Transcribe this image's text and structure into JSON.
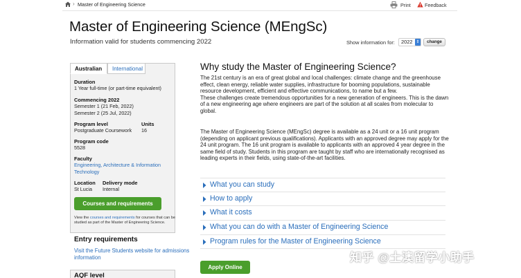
{
  "breadcrumb": {
    "current": "Master of Engineering Science"
  },
  "toolbar": {
    "print_label": "Print",
    "feedback_label": "Feedback"
  },
  "header": {
    "title": "Master of Engineering Science (MEngSc)",
    "subtitle": "Information valid for students commencing 2022",
    "show_info_label": "Show information for:",
    "year_value": "2022",
    "change_label": "change"
  },
  "sidebar": {
    "tabs": [
      "Australian",
      "International"
    ],
    "duration_label": "Duration",
    "duration_value": "1 Year full-time (or part-time equivalent)",
    "commencing_label": "Commencing 2022",
    "commencing_sem1": "Semester 1 (21 Feb, 2022)",
    "commencing_sem2": "Semester 2 (25 Jul, 2022)",
    "program_level_label": "Program level",
    "program_level_value": "Postgraduate Coursework",
    "units_label": "Units",
    "units_value": "16",
    "program_code_label": "Program code",
    "program_code_value": "5528",
    "faculty_label": "Faculty",
    "faculty_value": "Engineering, Architecture & Information Technology",
    "location_label": "Location",
    "location_value": "St Lucia",
    "delivery_label": "Delivery mode",
    "delivery_value": "Internal",
    "courses_button": "Courses and requirements",
    "note_prefix": "View the ",
    "note_link": "courses and requirements",
    "note_suffix": " for courses that can be studied as part of the Master of Engineering Science.",
    "entry_heading": "Entry requirements",
    "entry_link": "Visit the Future Students website for admissions information",
    "aqf_heading": "AQF level"
  },
  "main": {
    "heading": "Why study the Master of Engineering Science?",
    "paragraph1a": "The 21st century is an era of great global and local challenges: climate change and the greenhouse effect, clean energy, reliable water supplies, infrastructure for booming populations, sustainable resource development, efficient and effective communications, to name but a few.",
    "paragraph1b": "These challenges create tremendous opportunities for a new generation of engineers. This is the dawn of a new engineering age where engineers are part of the solution at all scales from molecular to global.",
    "paragraph2": "The Master of Engineering Science (MEngSc) degree is available as a 24 unit or a 16 unit program (depending on applicant previous qualifications). Applicants with an approved degree may apply for the 24 unit program. The 16 unit program is available to applicants with an approved 4 year degree in the same field of study. Students in this program are taught by staff who are internationally recognised as leading experts in their fields, using state-of-the-art facilities.",
    "accordion": [
      "What you can study",
      "How to apply",
      "What it costs",
      "What you can do with a Master of Engineering Science",
      "Program rules for the Master of Engineering Science"
    ],
    "apply_button": "Apply Online"
  },
  "watermark": "知乎 @土澳留学小助手",
  "colors": {
    "link": "#2a6ebb",
    "button_green": "#4a9e2c",
    "sidebar_bg": "#f2f2f2"
  }
}
